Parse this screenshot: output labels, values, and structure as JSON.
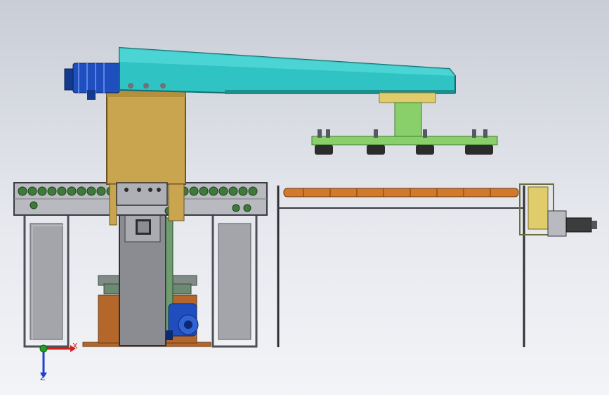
{
  "view": {
    "background_top": "#c9cdd6",
    "background_bottom": "#f3f4f7"
  },
  "colors": {
    "arm": "#2fc3c3",
    "arm_dark": "#1a8f90",
    "column": "#c9a54f",
    "column_dark": "#8e7433",
    "bracket": "#e0cc6a",
    "suction_frame": "#8ad06a",
    "suction_frame_dark": "#4f9a3b",
    "frame": "#9a9ca3",
    "frame_dark": "#4e5057",
    "conveyor_base": "#b8babf",
    "roller_green": "#3f7a3a",
    "roller_orange": "#d27a2c",
    "motor_blue": "#1f4fbf",
    "gear_box": "#b4672a",
    "gripper_dark": "#2c2c2c"
  },
  "axes_triad": {
    "x_label": "X",
    "z_label": "Z",
    "x_color": "#d02020",
    "y_color": "#20a020",
    "z_color": "#2040d0"
  }
}
